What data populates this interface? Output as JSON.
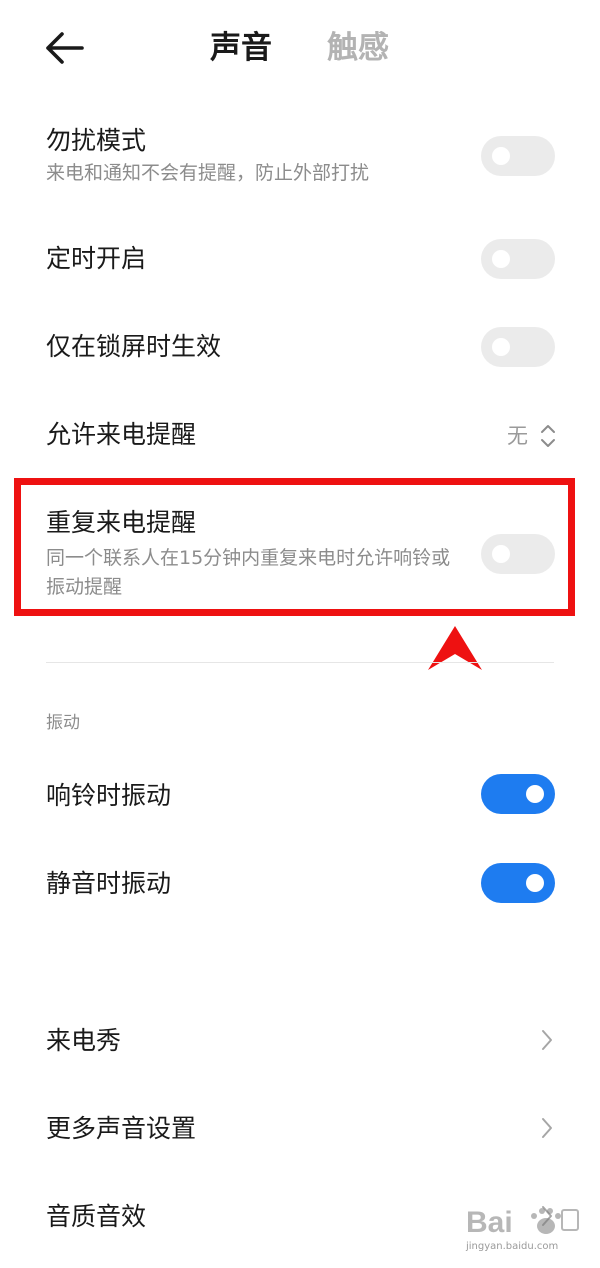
{
  "header": {
    "active_tab": "声音",
    "inactive_tab": "触感"
  },
  "rows": {
    "dnd": {
      "title": "勿扰模式",
      "subtitle": "来电和通知不会有提醒，防止外部打扰",
      "enabled": false
    },
    "scheduled": {
      "title": "定时开启",
      "enabled": false
    },
    "lockscreen_only": {
      "title": "仅在锁屏时生效",
      "enabled": false
    },
    "allow_calls": {
      "title": "允许来电提醒",
      "value": "无"
    },
    "repeat_calls": {
      "title": "重复来电提醒",
      "subtitle": "同一个联系人在15分钟内重复来电时允许响铃或振动提醒",
      "enabled": false
    }
  },
  "vibration": {
    "section_title": "振动",
    "ring_vibrate": {
      "title": "响铃时振动",
      "enabled": true
    },
    "silent_vibrate": {
      "title": "静音时振动",
      "enabled": true
    }
  },
  "more": {
    "caller_show": {
      "title": "来电秀"
    },
    "more_sound": {
      "title": "更多声音设置"
    },
    "audio_quality": {
      "title": "音质音效"
    }
  },
  "watermark": {
    "text": "jingyan.baidu.com",
    "logo": "baidu-jingyan-logo"
  },
  "colors": {
    "toggle_on": "#1e7cf0",
    "toggle_off": "#ebebeb",
    "highlight": "#ee1111"
  },
  "icons": {
    "back": "back-arrow-icon",
    "updown": "updown-chevron-icon",
    "chevron": "chevron-right-icon"
  }
}
